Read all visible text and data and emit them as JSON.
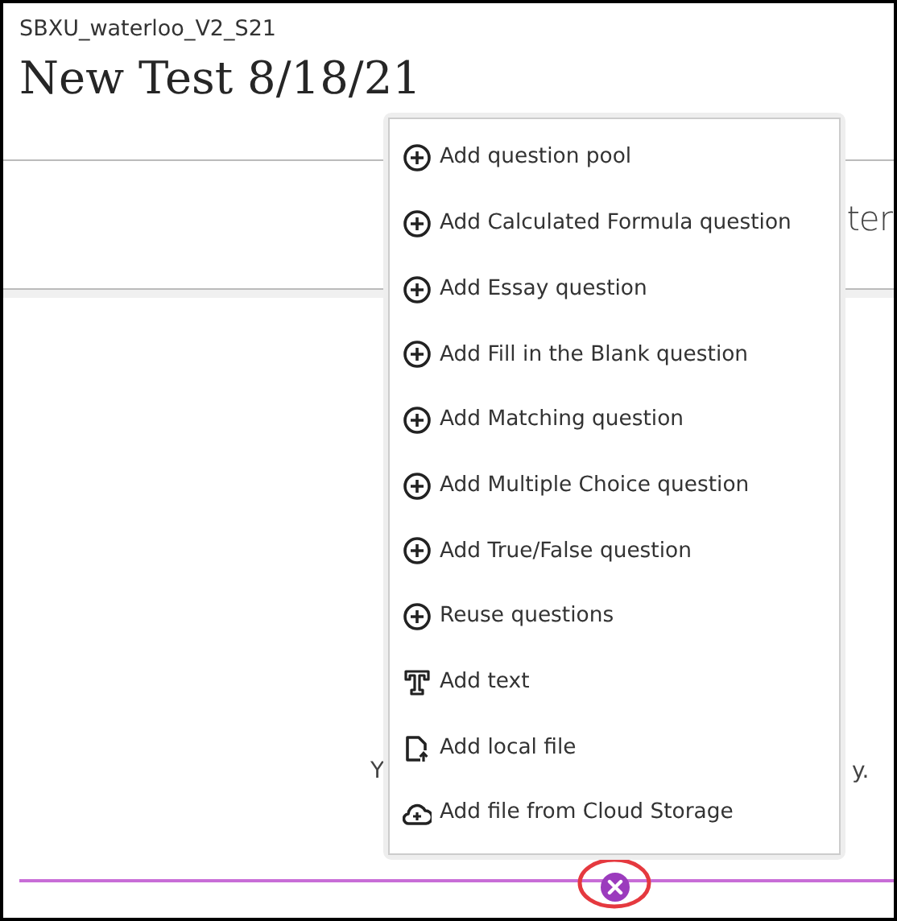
{
  "course": "SBXU_waterloo_V2_S21",
  "title": "New Test 8/18/21",
  "band_text": "ter",
  "body_fragments": [
    "Y",
    "y."
  ],
  "menu": [
    {
      "kind": "add",
      "label": "Add question pool"
    },
    {
      "kind": "add",
      "label": "Add Calculated Formula question"
    },
    {
      "kind": "add",
      "label": "Add Essay question"
    },
    {
      "kind": "add",
      "label": "Add Fill in the Blank question"
    },
    {
      "kind": "add",
      "label": "Add Matching question"
    },
    {
      "kind": "add",
      "label": "Add Multiple Choice question"
    },
    {
      "kind": "add",
      "label": "Add True/False question"
    },
    {
      "kind": "add",
      "label": "Reuse questions"
    },
    {
      "kind": "text",
      "label": "Add text"
    },
    {
      "kind": "file",
      "label": "Add local file"
    },
    {
      "kind": "cloud",
      "label": "Add file from Cloud Storage"
    }
  ]
}
